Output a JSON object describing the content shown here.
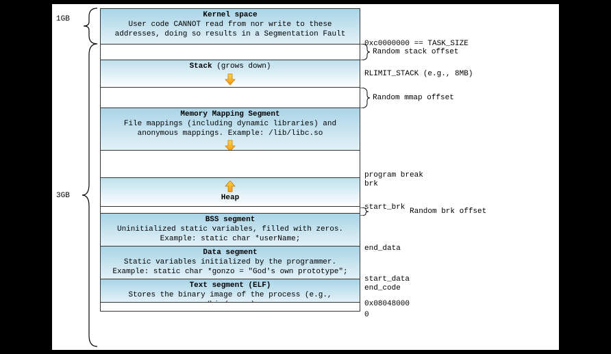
{
  "left": {
    "top_size": "1GB",
    "bottom_size": "3GB"
  },
  "segments": {
    "kernel": {
      "title": "Kernel space",
      "desc": "User code CANNOT read from nor write to these addresses, doing so results in a Segmentation Fault"
    },
    "stack": {
      "title": "Stack",
      "note": "(grows down)"
    },
    "mmap": {
      "title": "Memory Mapping Segment",
      "desc": "File mappings (including dynamic libraries) and anonymous mappings. Example: /lib/libc.so"
    },
    "heap": {
      "title": "Heap"
    },
    "bss": {
      "title": "BSS segment",
      "desc": "Uninitialized static variables, filled with zeros. Example: static char *userName;"
    },
    "data": {
      "title": "Data segment",
      "desc": "Static variables initialized by the programmer. Example: static char *gonzo = \"God's own prototype\";"
    },
    "text": {
      "title": "Text segment (ELF)",
      "desc": "Stores the binary image of the process (e.g., /bin/gonzo)"
    }
  },
  "right": {
    "task_size": "0xc0000000 == TASK_SIZE",
    "rand_stack": "Random stack offset",
    "rlimit_stack": "RLIMIT_STACK (e.g., 8MB)",
    "rand_mmap": "Random mmap offset",
    "program_break": "program break",
    "brk": "brk",
    "start_brk": "start_brk",
    "rand_brk": "Random brk offset",
    "end_data": "end_data",
    "start_data": "start_data",
    "end_code": "end_code",
    "text_addr": "0x08048000",
    "zero": "0"
  }
}
